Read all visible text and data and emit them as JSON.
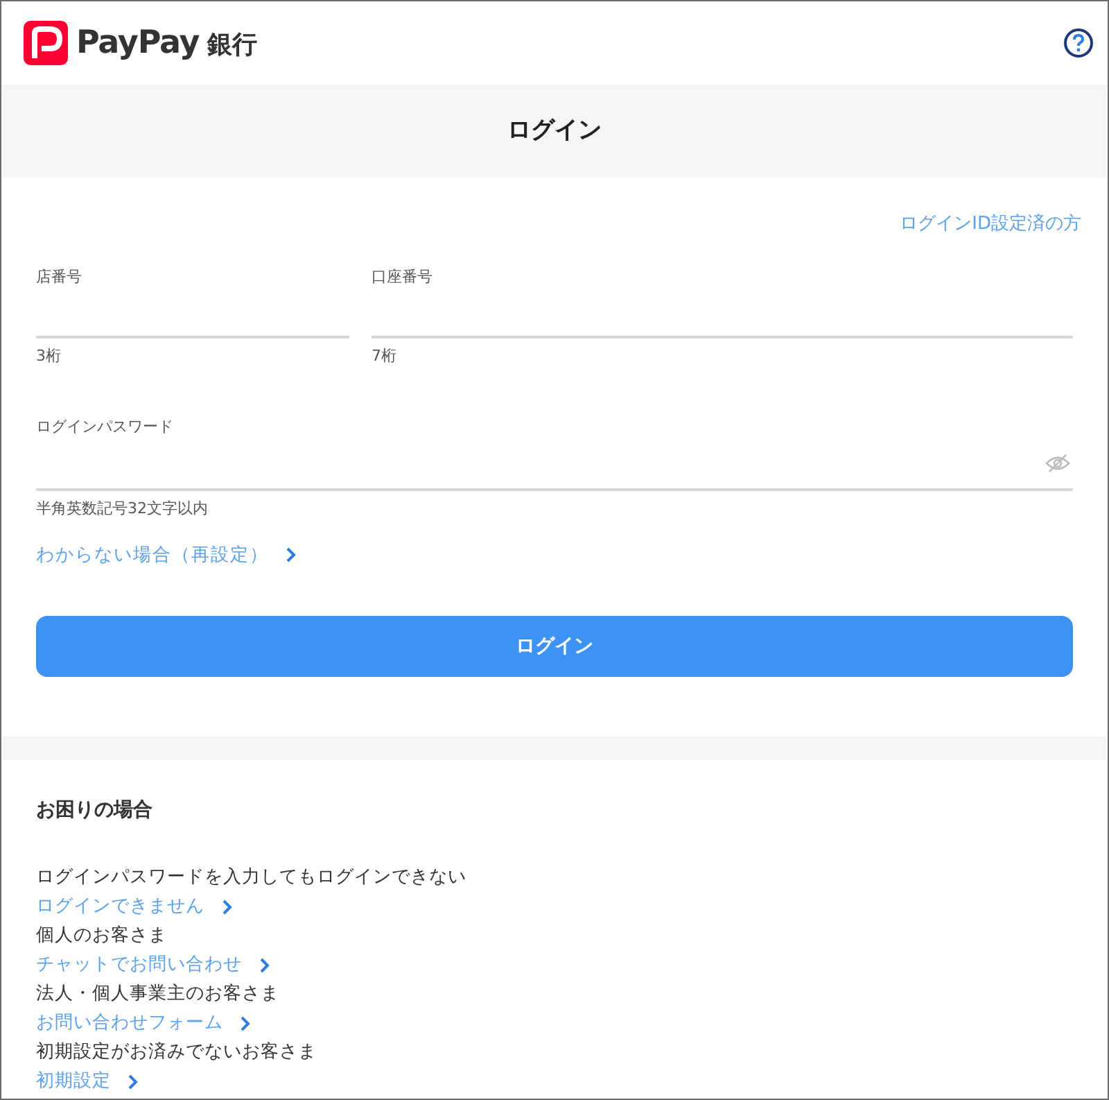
{
  "header": {
    "brand": "PayPay",
    "brand_suffix": "銀行"
  },
  "page_title": "ログイン",
  "login_id_link": "ログインID設定済の方",
  "account_fields": [
    {
      "label": "店番号",
      "hint": "3桁"
    },
    {
      "label": "口座番号",
      "hint": "7桁"
    }
  ],
  "password_field": {
    "label": "ログインパスワード",
    "hint": "半角英数記号32文字以内",
    "masked": true
  },
  "reset_link": "わからない場合（再設定）",
  "login_button": "ログイン",
  "help": {
    "title": "お困りの場合",
    "lines": [
      {
        "kind": "text",
        "text": "ログインパスワードを入力してもログインできない"
      },
      {
        "kind": "link",
        "text": "ログインできません"
      },
      {
        "kind": "text",
        "text": "個人のお客さま"
      },
      {
        "kind": "link",
        "text": "チャットでお問い合わせ"
      },
      {
        "kind": "text",
        "text": "法人・個人事業主のお客さま"
      },
      {
        "kind": "link",
        "text": "お問い合わせフォーム"
      },
      {
        "kind": "text",
        "text": "初期設定がお済みでないお客さま"
      },
      {
        "kind": "link",
        "text": "初期設定"
      }
    ]
  }
}
